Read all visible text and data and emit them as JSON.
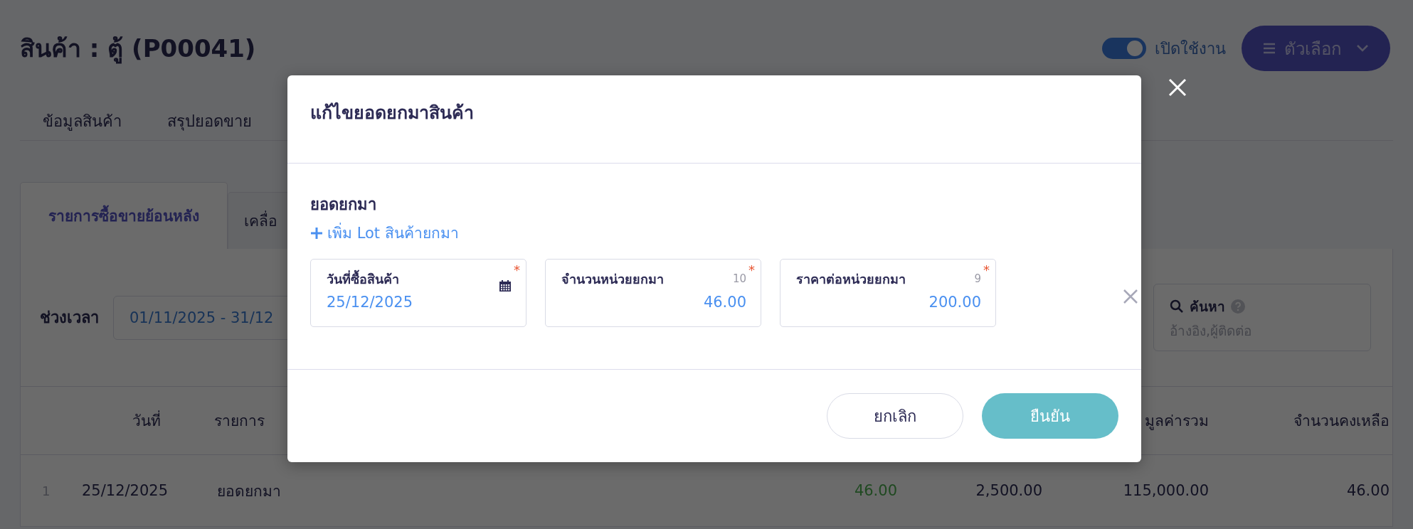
{
  "page": {
    "title": "สินค้า : ตู้ (P00041)",
    "active_toggle": {
      "label": "เปิดใช้งาน",
      "on": true
    },
    "options_button": {
      "label": "ตัวเลือก"
    }
  },
  "tabs": [
    {
      "label": "ข้อมูลสินค้า",
      "selected": false
    },
    {
      "label": "สรุปยอดขาย",
      "selected": false
    }
  ],
  "subtabs": [
    {
      "label": "รายการซื้อขายย้อนหลัง",
      "selected": true
    },
    {
      "label": "เคลื่อ",
      "selected": false
    }
  ],
  "filter": {
    "label": "ช่วงเวลา",
    "date_range": "01/11/2025 - 31/12"
  },
  "search": {
    "label": "ค้นหา",
    "placeholder": "อ้างอิง,ผู้ติดต่อ"
  },
  "table": {
    "columns": [
      {
        "label": "วันที่"
      },
      {
        "label": "รายการ"
      },
      {
        "label": "มูลค่ารวม"
      },
      {
        "label": "จำนวนคงเหลือ"
      }
    ],
    "rows": [
      {
        "index": "1",
        "date": "25/12/2025",
        "item": "ยอดยกมา",
        "qty_in": "46.00",
        "unit_price": "2,500.00",
        "total": "115,000.00",
        "balance": "46.00"
      }
    ]
  },
  "dialog": {
    "title": "แก้ไขยอดยกมาสินค้า",
    "section_title": "ยอดยกมา",
    "add_link": "เพิ่ม Lot สินค้ายกมา",
    "fields": [
      {
        "kind": "date",
        "label": "วันที่ซื้อสินค้า",
        "value": "25/12/2025",
        "required_mark": "*"
      },
      {
        "kind": "number",
        "label": "จำนวนหน่วยยกมา",
        "counter": "10",
        "value": "46.00",
        "required_mark": "*"
      },
      {
        "kind": "number",
        "label": "ราคาต่อหน่วยยกมา",
        "counter": "9",
        "value": "200.00",
        "required_mark": "*"
      }
    ],
    "cancel_button": "ยกเลิก",
    "confirm_button": "ยืนยัน"
  }
}
